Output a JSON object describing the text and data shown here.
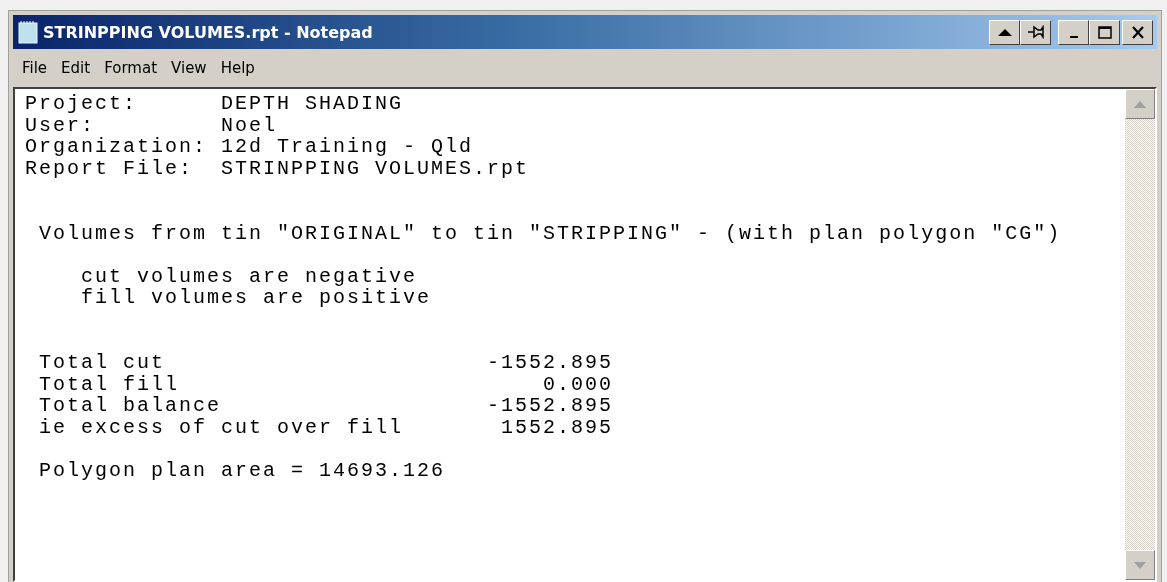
{
  "window": {
    "title": "STRINPPING VOLUMES.rpt - Notepad"
  },
  "menu": [
    "File",
    "Edit",
    "Format",
    "View",
    "Help"
  ],
  "document": {
    "text": "Project:      DEPTH SHADING\nUser:         Noel\nOrganization: 12d Training - Qld\nReport File:  STRINPPING VOLUMES.rpt\n\n\n Volumes from tin \"ORIGINAL\" to tin \"STRIPPING\" - (with plan polygon \"CG\")\n\n    cut volumes are negative\n    fill volumes are positive\n\n\n Total cut                       -1552.895\n Total fill                          0.000\n Total balance                   -1552.895\n ie excess of cut over fill       1552.895\n\n Polygon plan area = 14693.126"
  }
}
